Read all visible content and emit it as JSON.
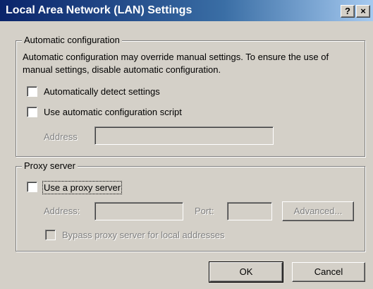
{
  "window": {
    "title": "Local Area Network (LAN) Settings",
    "help_label": "?",
    "close_label": "×"
  },
  "auto_config": {
    "legend": "Automatic configuration",
    "description": "Automatic configuration may override manual settings.  To ensure the use of manual settings, disable automatic configuration.",
    "auto_detect_label": "Automatically detect settings",
    "auto_detect_checked": false,
    "script_label": "Use automatic configuration script",
    "script_checked": false,
    "address_label": "Address",
    "address_value": ""
  },
  "proxy": {
    "legend": "Proxy server",
    "use_proxy_label": "Use a proxy server",
    "use_proxy_checked": false,
    "address_label": "Address:",
    "address_value": "",
    "port_label": "Port:",
    "port_value": "",
    "advanced_label": "Advanced...",
    "bypass_label": "Bypass proxy server for local addresses",
    "bypass_checked": false
  },
  "buttons": {
    "ok_label": "OK",
    "cancel_label": "Cancel"
  }
}
